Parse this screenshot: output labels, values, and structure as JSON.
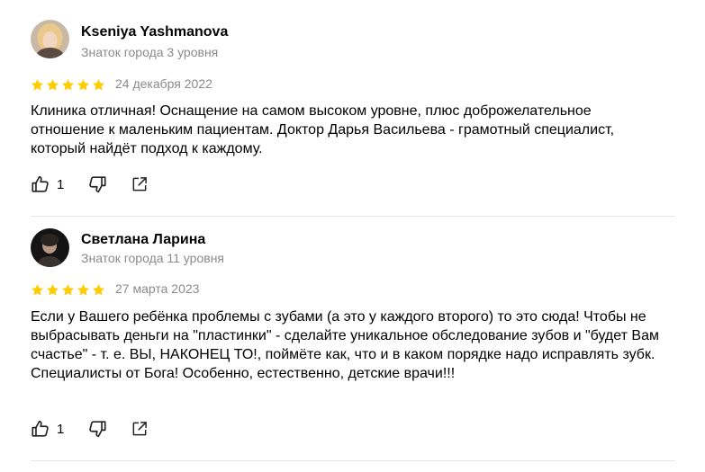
{
  "reviews": [
    {
      "author": "Kseniya Yashmanova",
      "level": "Знаток города 3 уровня",
      "rating": 5,
      "date": "24 декабря 2022",
      "text": "Клиника отличная! Оснащение на самом высоком уровне, плюс доброжелательное отношение к маленьким пациентам. Доктор Дарья Васильева - грамотный специалист, который найдёт подход к каждому.",
      "likes": "1"
    },
    {
      "author": "Светлана Ларина",
      "level": "Знаток города 11 уровня",
      "rating": 5,
      "date": "27 марта 2023",
      "text": "Если у Вашего ребёнка проблемы с зубами (а это у каждого второго) то это сюда! Чтобы не выбрасывать деньги на \"пластинки\" - сделайте уникальное обследование зубов и \"будет Вам счастье\" - т. е. ВЫ, НАКОНЕЦ ТО!, поймёте как, что и в каком порядке надо исправлять зубк. Специалисты от Бога! Особенно, естественно, детские врачи!!!",
      "likes": "1"
    }
  ],
  "colors": {
    "star": "#fc0",
    "muted_text": "#8a8a8a",
    "icon": "#222222"
  },
  "icons": {
    "rating": "star-icon",
    "like": "thumbs-up-icon",
    "dislike": "thumbs-down-icon",
    "share": "share-external-icon"
  }
}
